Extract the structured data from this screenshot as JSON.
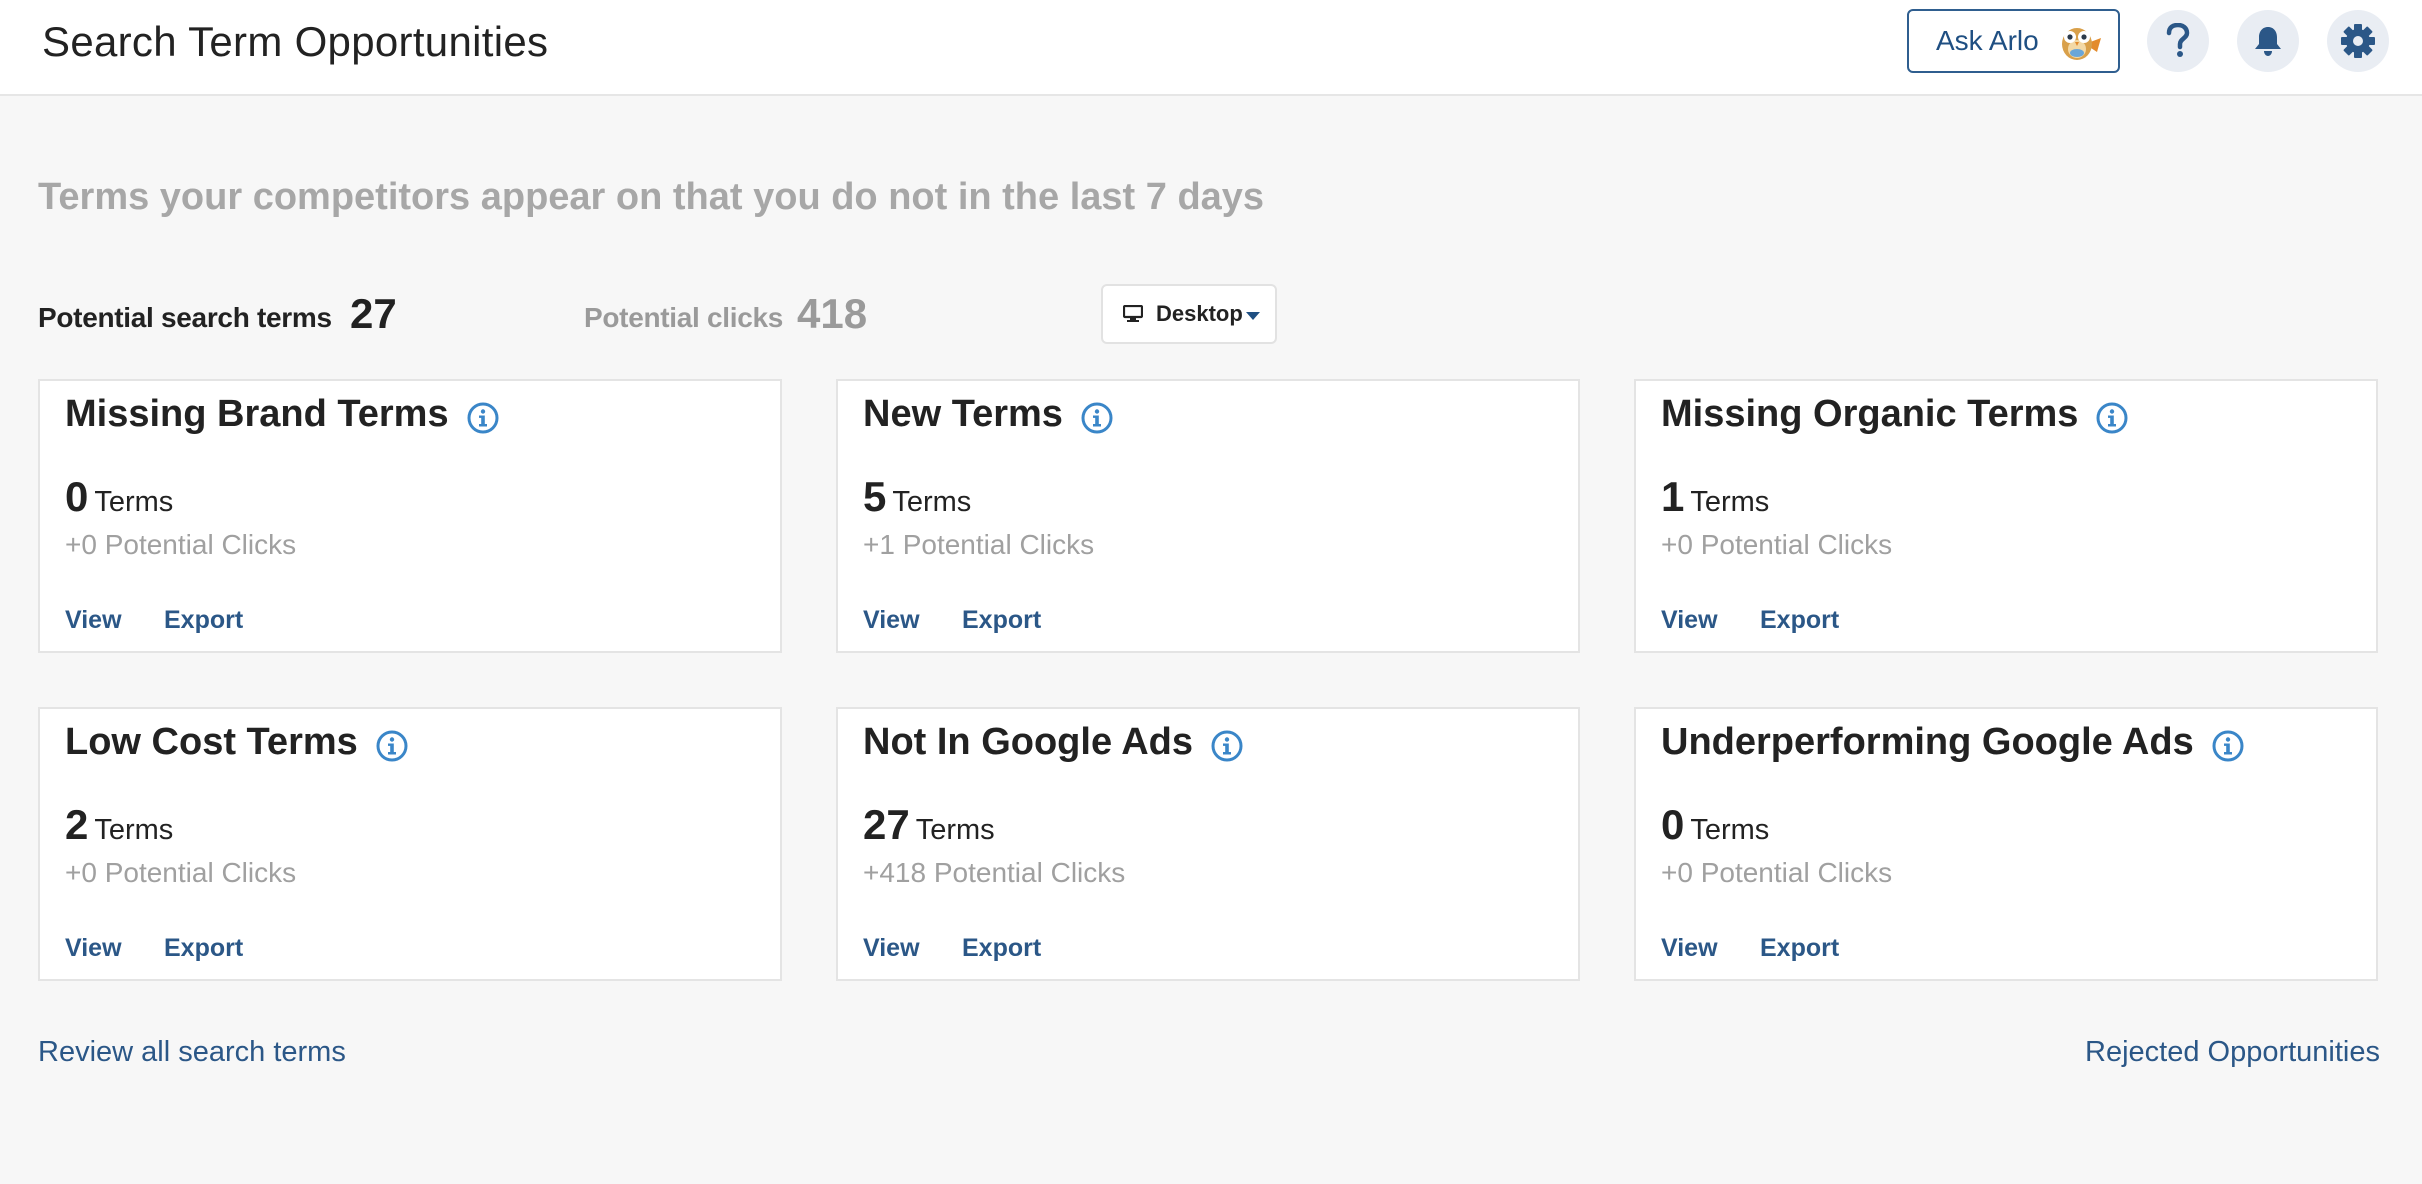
{
  "header": {
    "title": "Search Term Opportunities",
    "ask_label": "Ask Arlo",
    "icons": [
      "owl-mascot-icon",
      "help-icon",
      "bell-icon",
      "gear-icon"
    ]
  },
  "subtitle": "Terms your competitors appear on that you do not in the last 7 days",
  "stats": {
    "search_terms_label": "Potential search terms",
    "search_terms_value": "27",
    "clicks_label": "Potential clicks",
    "clicks_value": "418"
  },
  "device_dropdown": {
    "selected": "Desktop",
    "icon": "monitor-icon"
  },
  "cards": [
    {
      "title": "Missing Brand Terms",
      "count": "0",
      "unit": "Terms",
      "clicks": "+0 Potential Clicks",
      "view": "View",
      "export": "Export"
    },
    {
      "title": "New Terms",
      "count": "5",
      "unit": "Terms",
      "clicks": "+1 Potential Clicks",
      "view": "View",
      "export": "Export"
    },
    {
      "title": "Missing Organic Terms",
      "count": "1",
      "unit": "Terms",
      "clicks": "+0 Potential Clicks",
      "view": "View",
      "export": "Export"
    },
    {
      "title": "Low Cost Terms",
      "count": "2",
      "unit": "Terms",
      "clicks": "+0 Potential Clicks",
      "view": "View",
      "export": "Export"
    },
    {
      "title": "Not In Google Ads",
      "count": "27",
      "unit": "Terms",
      "clicks": "+418 Potential Clicks",
      "view": "View",
      "export": "Export"
    },
    {
      "title": "Underperforming Google Ads",
      "count": "0",
      "unit": "Terms",
      "clicks": "+0 Potential Clicks",
      "view": "View",
      "export": "Export"
    }
  ],
  "footer": {
    "review_link": "Review all search terms",
    "rejected_link": "Rejected Opportunities"
  },
  "colors": {
    "accent": "#2b5787",
    "info_icon": "#3a86c8",
    "muted_text": "#a0a0a0",
    "background": "#f7f7f7"
  }
}
